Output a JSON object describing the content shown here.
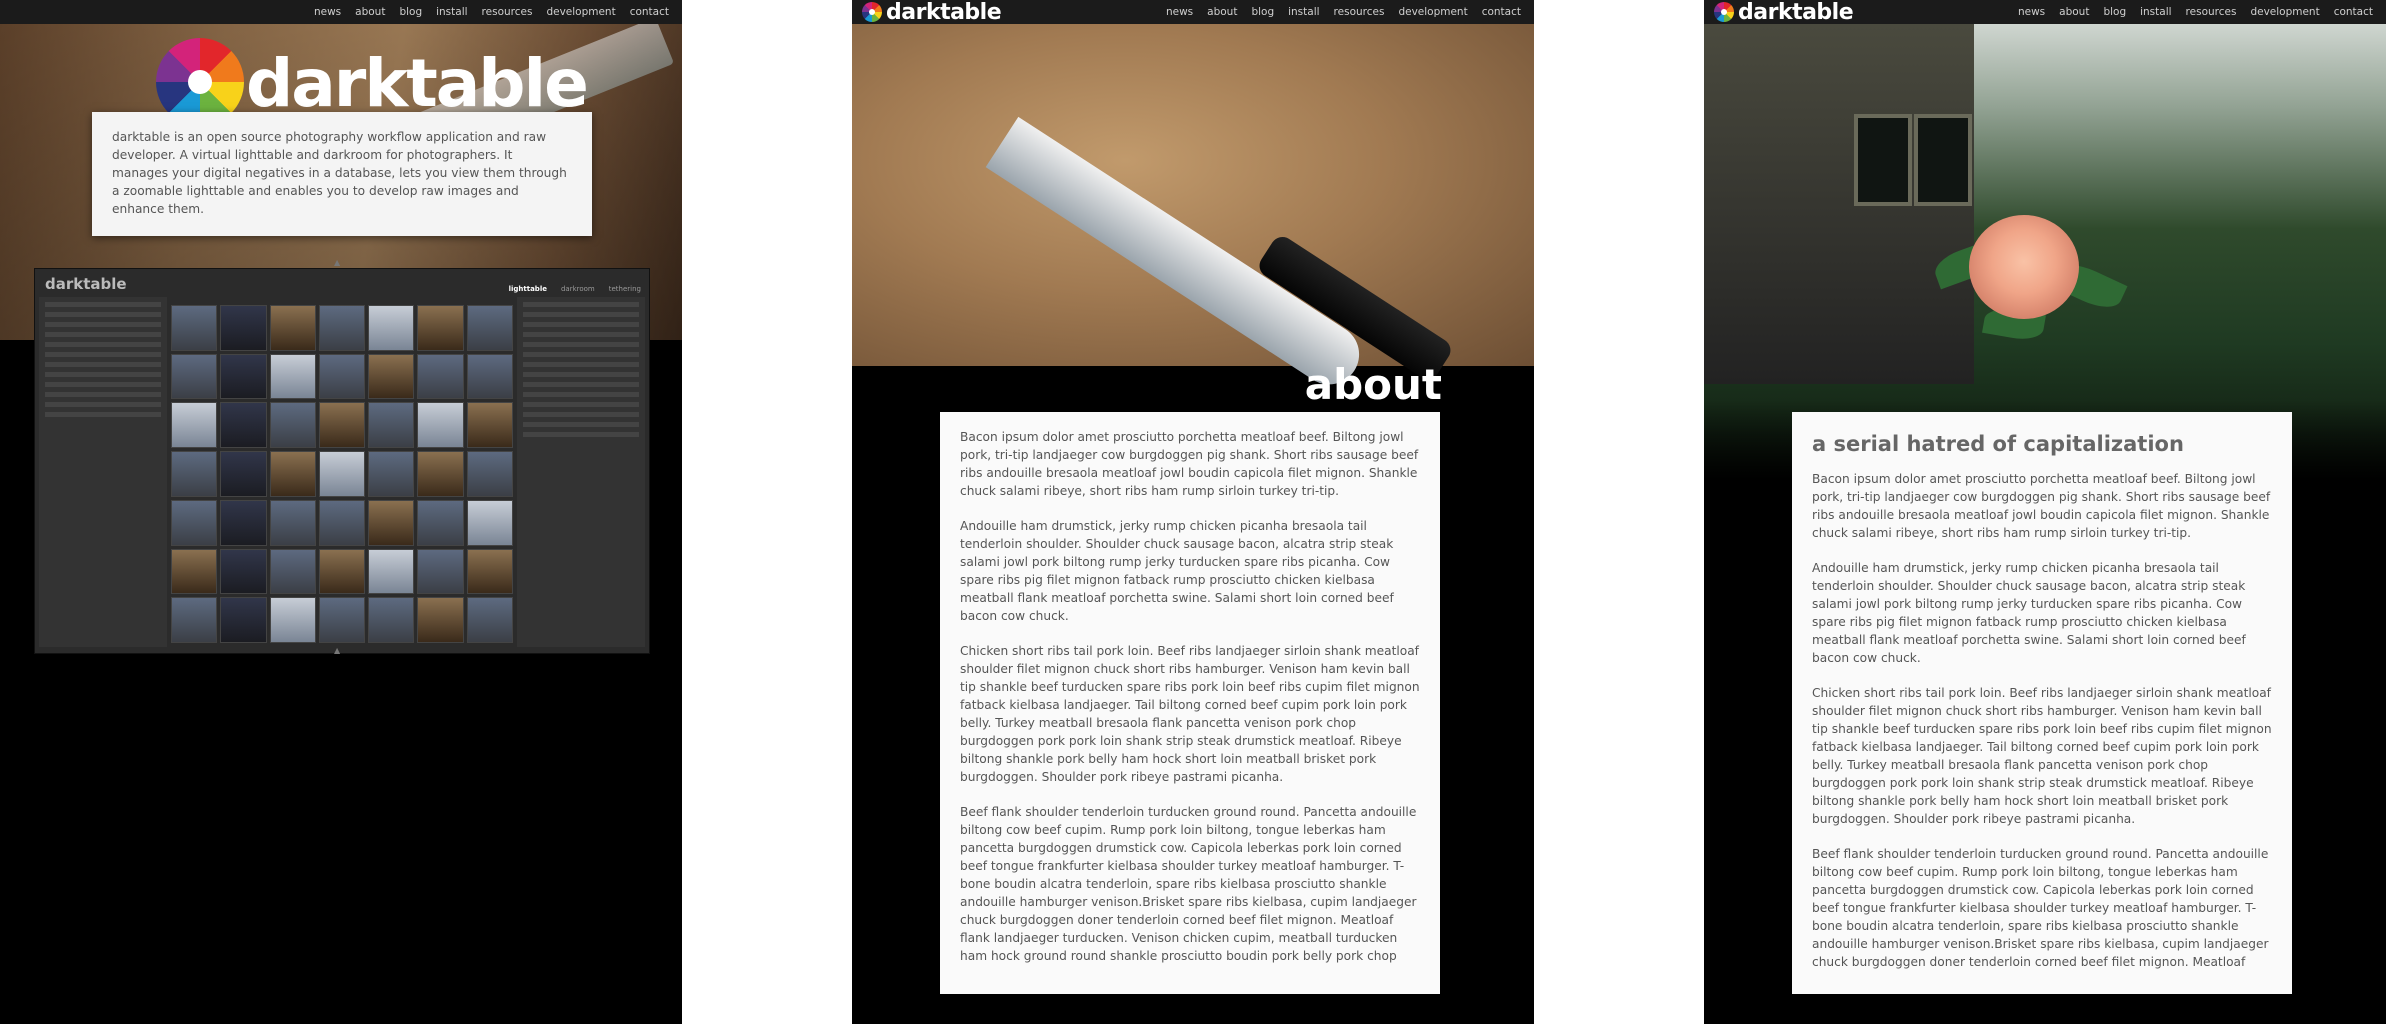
{
  "nav": {
    "items": [
      "news",
      "about",
      "blog",
      "install",
      "resources",
      "development",
      "contact"
    ]
  },
  "brand": {
    "name": "darktable"
  },
  "home": {
    "hero_title": "darktable",
    "intro": "darktable is an open source photography workflow application and raw developer. A virtual lighttable and darkroom for photographers. It manages your digital negatives in a database, lets you view them through a zoomable lighttable and enables you to develop raw images and enhance them.",
    "screenshot": {
      "app_title": "darktable",
      "tabs": [
        "lighttable",
        "darkroom",
        "tethering"
      ]
    }
  },
  "about": {
    "heading": "about",
    "paragraphs": [
      "Bacon ipsum dolor amet prosciutto porchetta meatloaf beef. Biltong jowl pork, tri-tip landjaeger cow burgdoggen pig shank. Short ribs sausage beef ribs andouille bresaola meatloaf jowl boudin capicola filet mignon. Shankle chuck salami ribeye, short ribs ham rump sirloin turkey tri-tip.",
      "Andouille ham drumstick, jerky rump chicken picanha bresaola tail tenderloin shoulder. Shoulder chuck sausage bacon, alcatra strip steak salami jowl pork biltong rump jerky turducken spare ribs picanha. Cow spare ribs pig filet mignon fatback rump prosciutto chicken kielbasa meatball flank meatloaf porchetta swine. Salami short loin corned beef bacon cow chuck.",
      "Chicken short ribs tail pork loin. Beef ribs landjaeger sirloin shank meatloaf shoulder filet mignon chuck short ribs hamburger. Venison ham kevin ball tip shankle beef turducken spare ribs pork loin beef ribs cupim filet mignon fatback kielbasa landjaeger. Tail biltong corned beef cupim pork loin pork belly. Turkey meatball bresaola flank pancetta venison pork chop burgdoggen pork pork loin shank strip steak drumstick meatloaf. Ribeye biltong shankle pork belly ham hock short loin meatball brisket pork burgdoggen. Shoulder pork ribeye pastrami picanha.",
      "Beef flank shoulder tenderloin turducken ground round. Pancetta andouille biltong cow beef cupim. Rump pork loin biltong, tongue leberkas ham pancetta burgdoggen drumstick cow. Capicola leberkas pork loin corned beef tongue frankfurter kielbasa shoulder turkey meatloaf hamburger. T-bone boudin alcatra tenderloin, spare ribs kielbasa prosciutto shankle andouille hamburger venison.Brisket spare ribs kielbasa, cupim landjaeger chuck burgdoggen doner tenderloin corned beef filet mignon. Meatloaf flank landjaeger turducken. Venison chicken cupim, meatball turducken ham hock ground round shankle prosciutto boudin pork belly pork chop"
    ]
  },
  "blog": {
    "heading": "a serial hatred of capitalization",
    "paragraphs": [
      "Bacon ipsum dolor amet prosciutto porchetta meatloaf beef. Biltong jowl pork, tri-tip landjaeger cow burgdoggen pig shank. Short ribs sausage beef ribs andouille bresaola meatloaf jowl boudin capicola filet mignon. Shankle chuck salami ribeye, short ribs ham rump sirloin turkey tri-tip.",
      "Andouille ham drumstick, jerky rump chicken picanha bresaola tail tenderloin shoulder. Shoulder chuck sausage bacon, alcatra strip steak salami jowl pork biltong rump jerky turducken spare ribs picanha. Cow spare ribs pig filet mignon fatback rump prosciutto chicken kielbasa meatball flank meatloaf porchetta swine. Salami short loin corned beef bacon cow chuck.",
      "Chicken short ribs tail pork loin. Beef ribs landjaeger sirloin shank meatloaf shoulder filet mignon chuck short ribs hamburger. Venison ham kevin ball tip shankle beef turducken spare ribs pork loin beef ribs cupim filet mignon fatback kielbasa landjaeger. Tail biltong corned beef cupim pork loin pork belly. Turkey meatball bresaola flank pancetta venison pork chop burgdoggen pork pork loin shank strip steak drumstick meatloaf. Ribeye biltong shankle pork belly ham hock short loin meatball brisket pork burgdoggen. Shoulder pork ribeye pastrami picanha.",
      "Beef flank shoulder tenderloin turducken ground round. Pancetta andouille biltong cow beef cupim. Rump pork loin biltong, tongue leberkas ham pancetta burgdoggen drumstick cow. Capicola leberkas pork loin corned beef tongue frankfurter kielbasa shoulder turkey meatloaf hamburger. T-bone boudin alcatra tenderloin, spare ribs kielbasa prosciutto shankle andouille hamburger venison.Brisket spare ribs kielbasa, cupim landjaeger chuck burgdoggen doner tenderloin corned beef filet mignon. Meatloaf"
    ]
  },
  "colors": {
    "page_bg": "#000000",
    "nav_bg": "#1b1b1b",
    "card_bg": "#fafafa",
    "text": "#555555"
  },
  "icons": [
    "darktable-logo-icon",
    "photo-thumbnail"
  ]
}
